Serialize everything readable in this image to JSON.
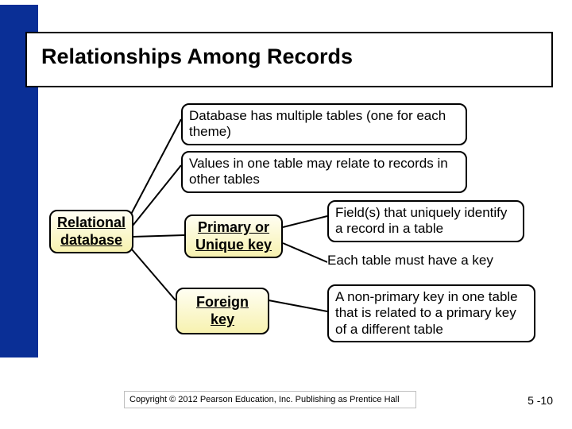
{
  "title": "Relationships Among Records",
  "boxes": {
    "multiple_tables": "Database has multiple tables (one for each theme)",
    "values_relate": "Values in one table may relate to records in other  tables",
    "relational_db_l1": "Relational",
    "relational_db_l2": "database",
    "primary_key_l1": "Primary or",
    "primary_key_l2": "Unique key",
    "foreign_key": "Foreign key",
    "field_unique": "Field(s) that uniquely identify a record in a table",
    "must_have_key": "Each table must have a key",
    "nonprimary": "A non-primary key in one table that is related to a primary key of a different table"
  },
  "footer": "Copyright © 2012 Pearson Education, Inc. Publishing as Prentice Hall",
  "pagenum": "5 -10"
}
